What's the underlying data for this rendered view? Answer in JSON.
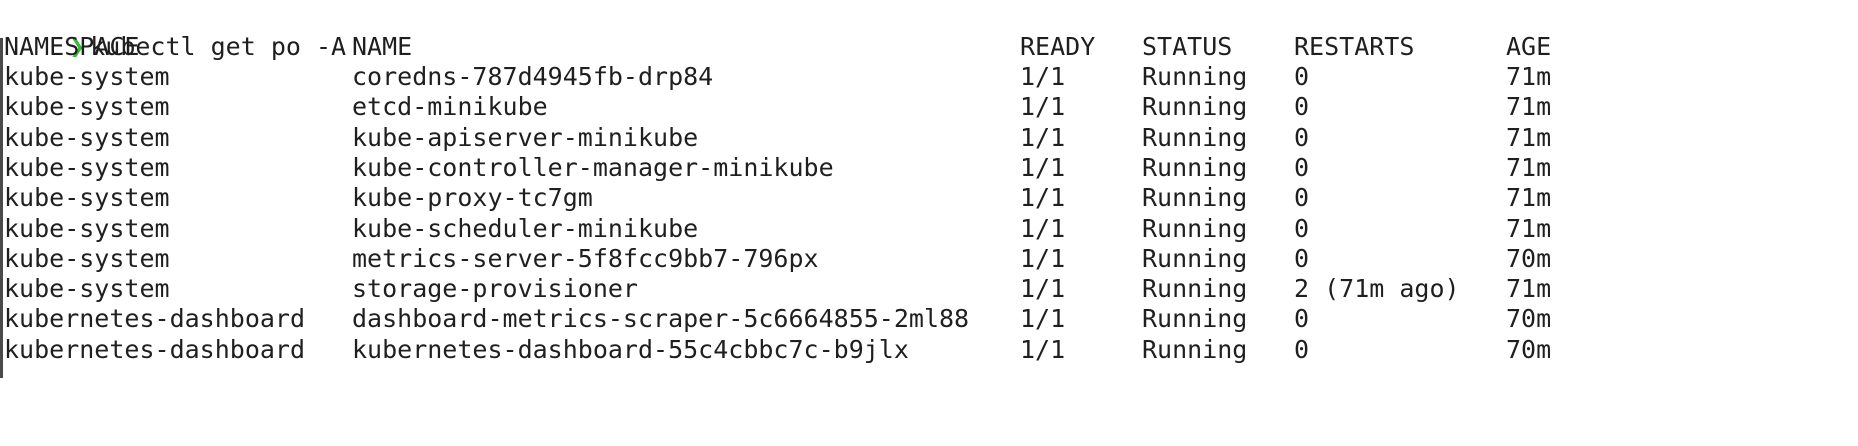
{
  "prompt": {
    "symbol": "❯",
    "command": "kubectl get po -A"
  },
  "table": {
    "headers": {
      "namespace": "NAMESPACE",
      "name": "NAME",
      "ready": "READY",
      "status": "STATUS",
      "restarts": "RESTARTS",
      "age": "AGE"
    },
    "rows": [
      {
        "namespace": "kube-system",
        "name": "coredns-787d4945fb-drp84",
        "ready": "1/1",
        "status": "Running",
        "restarts": "0",
        "age": "71m"
      },
      {
        "namespace": "kube-system",
        "name": "etcd-minikube",
        "ready": "1/1",
        "status": "Running",
        "restarts": "0",
        "age": "71m"
      },
      {
        "namespace": "kube-system",
        "name": "kube-apiserver-minikube",
        "ready": "1/1",
        "status": "Running",
        "restarts": "0",
        "age": "71m"
      },
      {
        "namespace": "kube-system",
        "name": "kube-controller-manager-minikube",
        "ready": "1/1",
        "status": "Running",
        "restarts": "0",
        "age": "71m"
      },
      {
        "namespace": "kube-system",
        "name": "kube-proxy-tc7gm",
        "ready": "1/1",
        "status": "Running",
        "restarts": "0",
        "age": "71m"
      },
      {
        "namespace": "kube-system",
        "name": "kube-scheduler-minikube",
        "ready": "1/1",
        "status": "Running",
        "restarts": "0",
        "age": "71m"
      },
      {
        "namespace": "kube-system",
        "name": "metrics-server-5f8fcc9bb7-796px",
        "ready": "1/1",
        "status": "Running",
        "restarts": "0",
        "age": "70m"
      },
      {
        "namespace": "kube-system",
        "name": "storage-provisioner",
        "ready": "1/1",
        "status": "Running",
        "restarts": "2 (71m ago)",
        "age": "71m"
      },
      {
        "namespace": "kubernetes-dashboard",
        "name": "dashboard-metrics-scraper-5c6664855-2ml88",
        "ready": "1/1",
        "status": "Running",
        "restarts": "0",
        "age": "70m"
      },
      {
        "namespace": "kubernetes-dashboard",
        "name": "kubernetes-dashboard-55c4cbbc7c-b9jlx",
        "ready": "1/1",
        "status": "Running",
        "restarts": "0",
        "age": "70m"
      }
    ]
  },
  "colors": {
    "prompt_accent": "#3cb83c",
    "text": "#1f1f1f",
    "background": "#ffffff"
  }
}
